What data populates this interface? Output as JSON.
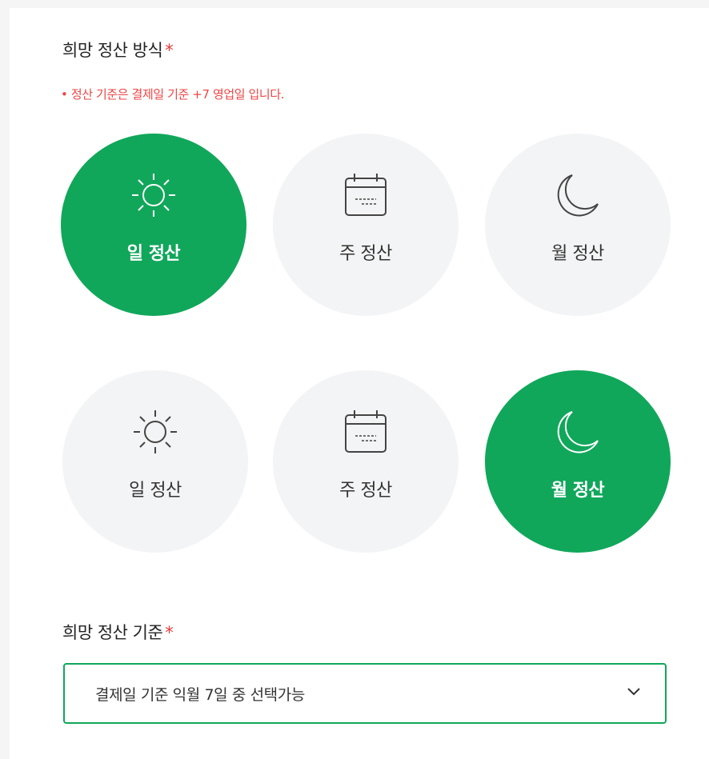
{
  "method": {
    "title": "희망 정산 방식",
    "required_mark": "*",
    "notice": "• 정산 기준은 결제일 기준 +7 영업일 입니다.",
    "rows": [
      {
        "options": [
          {
            "label": "일 정산",
            "icon": "sun-icon",
            "selected": true
          },
          {
            "label": "주 정산",
            "icon": "calendar-icon",
            "selected": false
          },
          {
            "label": "월 정산",
            "icon": "moon-icon",
            "selected": false
          }
        ]
      },
      {
        "options": [
          {
            "label": "일 정산",
            "icon": "sun-icon",
            "selected": false
          },
          {
            "label": "주 정산",
            "icon": "calendar-icon",
            "selected": false
          },
          {
            "label": "월 정산",
            "icon": "moon-icon",
            "selected": true
          }
        ]
      }
    ]
  },
  "criteria": {
    "title": "희망 정산 기준",
    "required_mark": "*",
    "selected_value": "결제일 기준 익월 7일 중 선택가능"
  },
  "colors": {
    "accent": "#10a75a",
    "required": "#e83a3a",
    "notice": "#ee4545",
    "option_bg": "#f3f4f6"
  }
}
